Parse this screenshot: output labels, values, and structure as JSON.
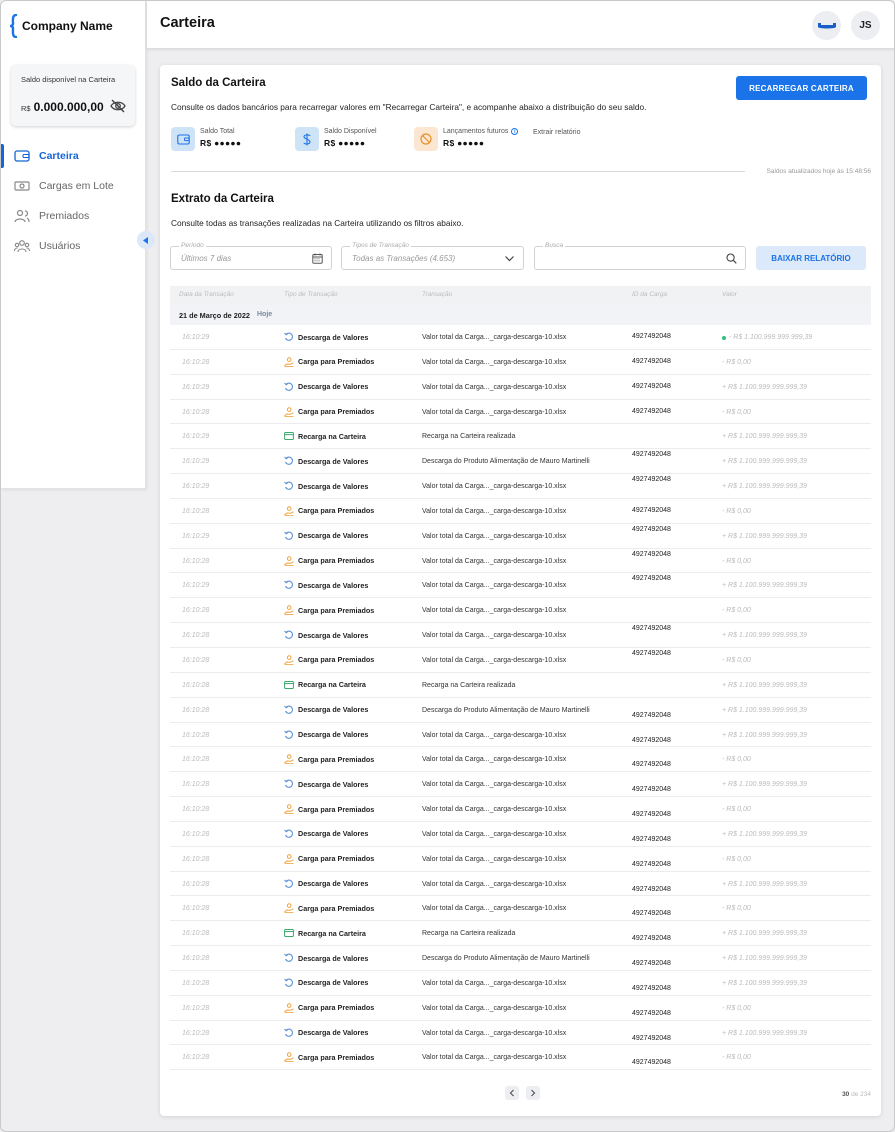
{
  "brand": {
    "name": "Company Name"
  },
  "sidebar": {
    "balance_label": "Saldo disponível na Carteira",
    "balance_currency": "R$",
    "balance_value": "0.000.000,00",
    "items": [
      {
        "label": "Carteira",
        "icon": "wallet-icon",
        "active": true
      },
      {
        "label": "Cargas em Lote",
        "icon": "money-icon",
        "active": false
      },
      {
        "label": "Premiados",
        "icon": "users-icon",
        "active": false
      },
      {
        "label": "Usuários",
        "icon": "user-group-icon",
        "active": false
      }
    ]
  },
  "header": {
    "title": "Carteira",
    "avatar_initials": "JS"
  },
  "wallet": {
    "title": "Saldo da Carteira",
    "description": "Consulte os dados bancários para recarregar valores em \"Recarregar Carteira\", e acompanhe abaixo a distribuição do seu saldo.",
    "recharge_button": "RECARREGAR CARTEIRA",
    "stats": [
      {
        "label": "Saldo Total",
        "value": "R$ ●●●●●",
        "color": "#cfe3f7"
      },
      {
        "label": "Saldo Disponível",
        "value": "R$ ●●●●●",
        "color": "#cfe3f7"
      },
      {
        "label": "Lançamentos futuros",
        "value": "R$ ●●●●●",
        "color": "#fbe6d2"
      }
    ],
    "extract_link": "Extrair relatório",
    "updated_text": "Saldos atualizados hoje às 15:48:56"
  },
  "statement": {
    "title": "Extrato da Carteira",
    "description": "Consulte todas as transações realizadas na Carteira utilizando os filtros abaixo.",
    "filters": {
      "period_label": "Período",
      "period_value": "Últimos 7 dias",
      "type_label": "Tipos de Transação",
      "type_value": "Todas as Transações (4.653)",
      "search_label": "Busca"
    },
    "download_button": "BAIXAR RELATÓRIO",
    "columns": [
      "Data da Transação",
      "Tipo de Transação",
      "Transação",
      "ID da Carga",
      "Valor"
    ],
    "date_group": "21 de Março de 2022",
    "date_tag": "Hoje",
    "rows": [
      {
        "time": "16:10:29",
        "type": "Descarga de Valores",
        "kind": "descarga",
        "desc": "Valor total da Carga..._carga-descarga-10.xlsx",
        "id": "4927492048",
        "id_offset": 0,
        "value": "- R$ 1.100.999.999.999,39",
        "dot": true
      },
      {
        "time": "16:10:28",
        "type": "Carga para Premiados",
        "kind": "carga",
        "desc": "Valor total da Carga..._carga-descarga-10.xlsx",
        "id": "4927492048",
        "id_offset": 0,
        "value": "- R$ 0,00",
        "dot": false
      },
      {
        "time": "16:10:29",
        "type": "Descarga de Valores",
        "kind": "descarga",
        "desc": "Valor total da Carga..._carga-descarga-10.xlsx",
        "id": "4927492048",
        "id_offset": 0,
        "value": "+ R$ 1.100.999.999.999,39",
        "dot": false
      },
      {
        "time": "16:10:28",
        "type": "Carga para Premiados",
        "kind": "carga",
        "desc": "Valor total da Carga..._carga-descarga-10.xlsx",
        "id": "4927492048",
        "id_offset": 0,
        "value": "- R$ 0,00",
        "dot": false
      },
      {
        "time": "16:10:29",
        "type": "Recarga na Carteira",
        "kind": "recarga",
        "desc": "Recarga na Carteira realizada",
        "id": "",
        "id_offset": 0,
        "value": "+ R$ 1.100.999.999.999,39",
        "dot": false
      },
      {
        "time": "16:10:29",
        "type": "Descarga de Valores",
        "kind": "descarga",
        "desc": "Descarga do Produto Alimentação de Mauro Martinelli",
        "id": "4927492048",
        "id_offset": -1,
        "value": "+ R$ 1.100.999.999.999,39",
        "dot": false
      },
      {
        "time": "16:10:29",
        "type": "Descarga de Valores",
        "kind": "descarga",
        "desc": "Valor total da Carga..._carga-descarga-10.xlsx",
        "id": "4927492048",
        "id_offset": -1,
        "value": "+ R$ 1.100.999.999.999,39",
        "dot": false
      },
      {
        "time": "16:10:28",
        "type": "Carga para Premiados",
        "kind": "carga",
        "desc": "Valor total da Carga..._carga-descarga-10.xlsx",
        "id": "4927492048",
        "id_offset": 0,
        "value": "- R$ 0,00",
        "dot": false
      },
      {
        "time": "16:10:29",
        "type": "Descarga de Valores",
        "kind": "descarga",
        "desc": "Valor total da Carga..._carga-descarga-10.xlsx",
        "id": "4927492048",
        "id_offset": -1,
        "value": "+ R$ 1.100.999.999.999,39",
        "dot": false
      },
      {
        "time": "16:10:28",
        "type": "Carga para Premiados",
        "kind": "carga",
        "desc": "Valor total da Carga..._carga-descarga-10.xlsx",
        "id": "4927492048",
        "id_offset": -1,
        "value": "- R$ 0,00",
        "dot": false
      },
      {
        "time": "16:10:29",
        "type": "Descarga de Valores",
        "kind": "descarga",
        "desc": "Valor total da Carga..._carga-descarga-10.xlsx",
        "id": "4927492048",
        "id_offset": -1,
        "value": "+ R$ 1.100.999.999.999,39",
        "dot": false
      },
      {
        "time": "16:10:28",
        "type": "Carga para Premiados",
        "kind": "carga",
        "desc": "Valor total da Carga..._carga-descarga-10.xlsx",
        "id": "",
        "id_offset": 0,
        "value": "- R$ 0,00",
        "dot": false
      },
      {
        "time": "16:10:28",
        "type": "Descarga de Valores",
        "kind": "descarga",
        "desc": "Valor total da Carga..._carga-descarga-10.xlsx",
        "id": "4927492048",
        "id_offset": -1,
        "value": "+ R$ 1.100.999.999.999,39",
        "dot": false
      },
      {
        "time": "16:10:28",
        "type": "Carga para Premiados",
        "kind": "carga",
        "desc": "Valor total da Carga..._carga-descarga-10.xlsx",
        "id": "4927492048",
        "id_offset": -1,
        "value": "- R$ 0,00",
        "dot": false
      },
      {
        "time": "16:10:28",
        "type": "Recarga na Carteira",
        "kind": "recarga",
        "desc": "Recarga na Carteira realizada",
        "id": "",
        "id_offset": 0,
        "value": "+ R$ 1.100.999.999.999,39",
        "dot": false
      },
      {
        "time": "16:10:28",
        "type": "Descarga de Valores",
        "kind": "descarga",
        "desc": "Descarga do Produto Alimentação de Mauro Martinelli",
        "id": "4927492048",
        "id_offset": 1,
        "value": "+ R$ 1.100.999.999.999,39",
        "dot": false
      },
      {
        "time": "16:10:28",
        "type": "Descarga de Valores",
        "kind": "descarga",
        "desc": "Valor total da Carga..._carga-descarga-10.xlsx",
        "id": "4927492048",
        "id_offset": 1,
        "value": "+ R$ 1.100.999.999.999,39",
        "dot": false
      },
      {
        "time": "16:10:28",
        "type": "Carga para Premiados",
        "kind": "carga",
        "desc": "Valor total da Carga..._carga-descarga-10.xlsx",
        "id": "4927492048",
        "id_offset": 1,
        "value": "- R$ 0,00",
        "dot": false
      },
      {
        "time": "16:10:28",
        "type": "Descarga de Valores",
        "kind": "descarga",
        "desc": "Valor total da Carga..._carga-descarga-10.xlsx",
        "id": "4927492048",
        "id_offset": 1,
        "value": "+ R$ 1.100.999.999.999,39",
        "dot": false
      },
      {
        "time": "16:10:28",
        "type": "Carga para Premiados",
        "kind": "carga",
        "desc": "Valor total da Carga..._carga-descarga-10.xlsx",
        "id": "4927492048",
        "id_offset": 1,
        "value": "- R$ 0,00",
        "dot": false
      },
      {
        "time": "16:10:28",
        "type": "Descarga de Valores",
        "kind": "descarga",
        "desc": "Valor total da Carga..._carga-descarga-10.xlsx",
        "id": "4927492048",
        "id_offset": 1,
        "value": "+ R$ 1.100.999.999.999,39",
        "dot": false
      },
      {
        "time": "16:10:28",
        "type": "Carga para Premiados",
        "kind": "carga",
        "desc": "Valor total da Carga..._carga-descarga-10.xlsx",
        "id": "4927492048",
        "id_offset": 1,
        "value": "- R$ 0,00",
        "dot": false
      },
      {
        "time": "16:10:28",
        "type": "Descarga de Valores",
        "kind": "descarga",
        "desc": "Valor total da Carga..._carga-descarga-10.xlsx",
        "id": "4927492048",
        "id_offset": 1,
        "value": "+ R$ 1.100.999.999.999,39",
        "dot": false
      },
      {
        "time": "16:10:28",
        "type": "Carga para Premiados",
        "kind": "carga",
        "desc": "Valor total da Carga..._carga-descarga-10.xlsx",
        "id": "4927492048",
        "id_offset": 1,
        "value": "- R$ 0,00",
        "dot": false
      },
      {
        "time": "16:10:28",
        "type": "Recarga na Carteira",
        "kind": "recarga",
        "desc": "Recarga na Carteira realizada",
        "id": "4927492048",
        "id_offset": 1,
        "value": "+ R$ 1.100.999.999.999,39",
        "dot": false
      },
      {
        "time": "16:10:28",
        "type": "Descarga de Valores",
        "kind": "descarga",
        "desc": "Descarga do Produto Alimentação de Mauro Martinelli",
        "id": "4927492048",
        "id_offset": 1,
        "value": "+ R$ 1.100.999.999.999,39",
        "dot": false
      },
      {
        "time": "16:10:28",
        "type": "Descarga de Valores",
        "kind": "descarga",
        "desc": "Valor total da Carga..._carga-descarga-10.xlsx",
        "id": "4927492048",
        "id_offset": 1,
        "value": "+ R$ 1.100.999.999.999,39",
        "dot": false
      },
      {
        "time": "16:10:28",
        "type": "Carga para Premiados",
        "kind": "carga",
        "desc": "Valor total da Carga..._carga-descarga-10.xlsx",
        "id": "4927492048",
        "id_offset": 1,
        "value": "- R$ 0,00",
        "dot": false
      },
      {
        "time": "16:10:28",
        "type": "Descarga de Valores",
        "kind": "descarga",
        "desc": "Valor total da Carga..._carga-descarga-10.xlsx",
        "id": "4927492048",
        "id_offset": 1,
        "value": "+ R$ 1.100.999.999.999,39",
        "dot": false
      },
      {
        "time": "16:10:28",
        "type": "Carga para Premiados",
        "kind": "carga",
        "desc": "Valor total da Carga..._carga-descarga-10.xlsx",
        "id": "4927492048",
        "id_offset": 1,
        "value": "- R$ 0,00",
        "dot": false
      }
    ],
    "pagination": {
      "current": "30",
      "of_text": "de 234"
    }
  },
  "colors": {
    "accent": "#1a73e8",
    "active_nav": "#1565d8",
    "carga_icon": "#f0a23a",
    "descarga_icon": "#5a8fd8",
    "recarga_icon": "#3aa96b"
  }
}
